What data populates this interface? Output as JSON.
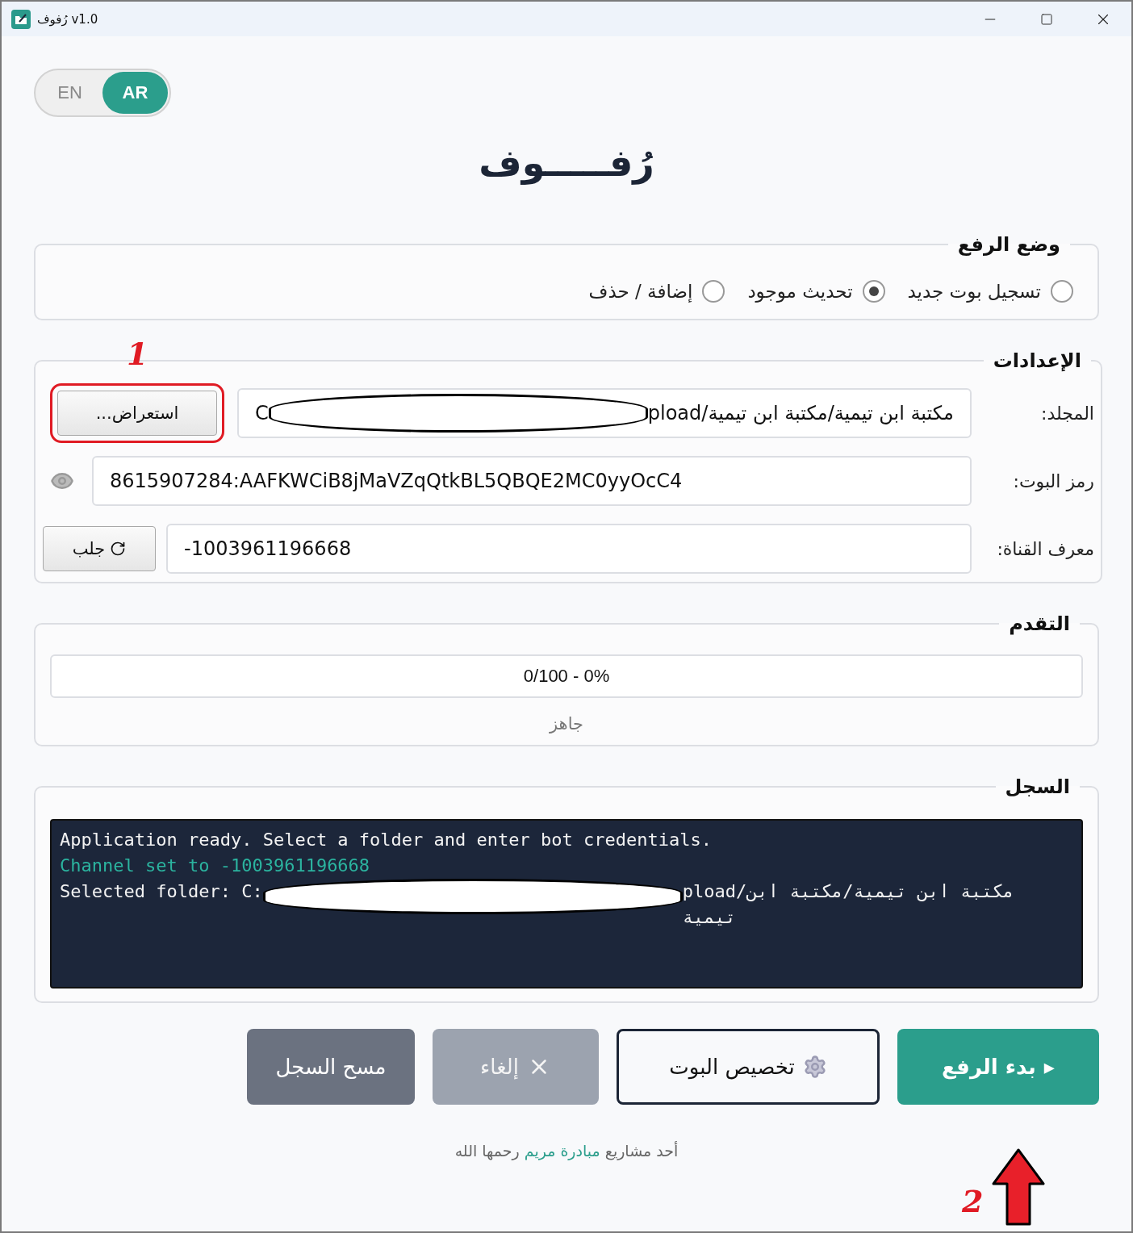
{
  "window": {
    "title": "رُفوف v1.0"
  },
  "language_toggle": [
    {
      "label": "AR",
      "selected": true
    },
    {
      "label": "EN",
      "selected": false
    }
  ],
  "app_title": "رُفـــــوف",
  "upload_mode": {
    "title": "وضع الرفع",
    "options": [
      {
        "label": "تسجيل بوت جديد",
        "selected": false
      },
      {
        "label": "تحديث موجود",
        "selected": true
      },
      {
        "label": "إضافة / حذف",
        "selected": false
      }
    ]
  },
  "settings": {
    "title": "الإعدادات",
    "folder": {
      "label": "المجلد:",
      "value_start": "C",
      "value_end": "pload/مكتبة ابن تيمية/مكتبة ابن تيمية",
      "button": "استعراض..."
    },
    "bot_token": {
      "label": "رمز البوت:",
      "value": "8615907284:AAFKWCiB8jMaVZqQtkBL5QBQE2MC0yyOcC4"
    },
    "channel_id": {
      "label": "معرف القناة:",
      "value": "-1003961196668",
      "button": "جلب"
    }
  },
  "progress": {
    "title": "التقدم",
    "level": 0,
    "text": "0/100 - 0%",
    "status": "جاهز"
  },
  "log": {
    "title": "السجل",
    "lines": [
      {
        "kind": "info",
        "text": "Application ready. Select a folder and enter bot credentials."
      },
      {
        "kind": "success",
        "text": "Channel set to -1003961196668"
      },
      {
        "kind": "redacted",
        "text": "Selected folder: C:",
        "text_end": "pload/مكتبة ابن تيمية/مكتبة ابن تيمية"
      }
    ]
  },
  "buttons": [
    {
      "kind": "primary",
      "glyph": "▸",
      "label": "بدء الرفع",
      "disabled": false
    },
    {
      "kind": "outline",
      "label": "تخصيص البوت",
      "disabled": false
    },
    {
      "kind": "cancel",
      "label": "إلغاء",
      "disabled": true
    },
    {
      "kind": "secondary",
      "label": "مسح السجل",
      "disabled": false
    }
  ],
  "footer": {
    "before": "أحد مشاريع",
    "link": "مبادرة مريم",
    "after": "رحمها الله"
  },
  "annotations": [
    {
      "kind": "number",
      "text": "1"
    },
    {
      "kind": "number",
      "text": "2"
    },
    {
      "kind": "arrow"
    }
  ]
}
